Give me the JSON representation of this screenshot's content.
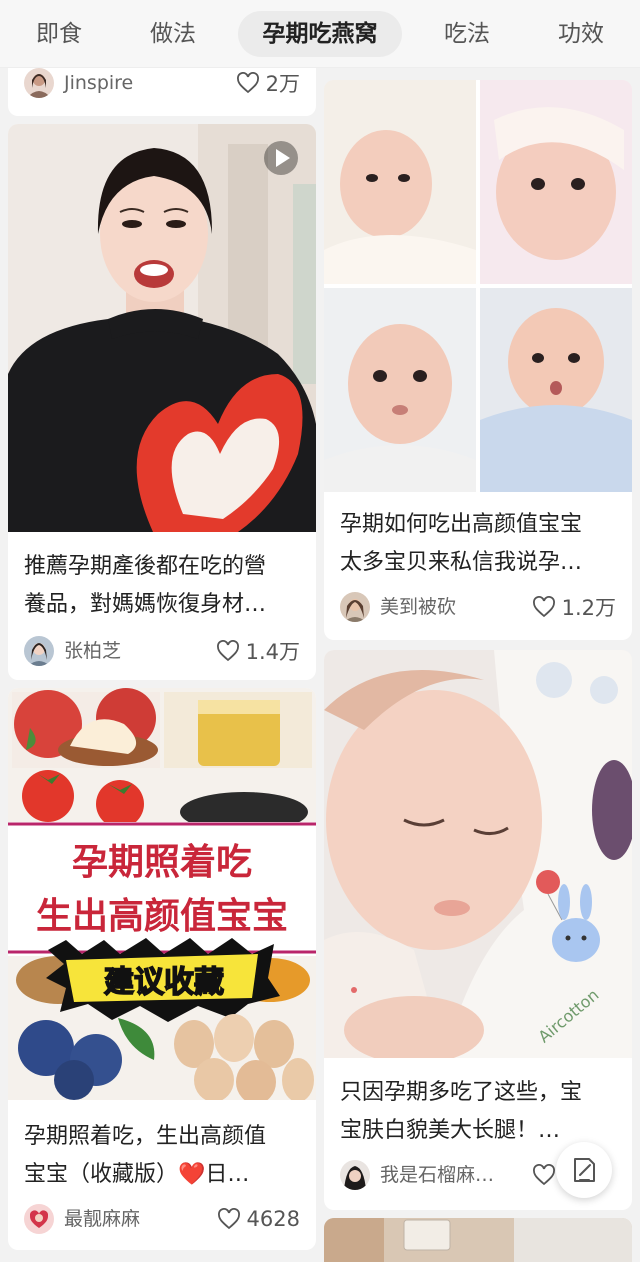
{
  "tabs": [
    {
      "label": "即食"
    },
    {
      "label": "做法"
    },
    {
      "label": "孕期吃燕窝"
    },
    {
      "label": "吃法"
    },
    {
      "label": "功效"
    }
  ],
  "posts": [
    {
      "author": "Jinspire",
      "likes": "2万"
    },
    {
      "title_lines": [
        "推薦孕期產後都在吃的營",
        "養品，對媽媽恢復身材…"
      ],
      "author": "张柏芝",
      "likes": "1.4万"
    },
    {
      "title_lines": [
        "孕期照着吃，生出高颜值",
        "宝宝（收藏版）❤️日…"
      ],
      "author": "最靓麻麻",
      "likes": "4628",
      "cover": {
        "line1": "孕期照着吃",
        "line2": "生出高颜值宝宝",
        "sticker": "建议收藏"
      }
    },
    {
      "title_lines": [
        "孕期如何吃出高颜值宝宝",
        "太多宝贝来私信我说孕…"
      ],
      "author": "美到被砍",
      "likes": "1.2万"
    },
    {
      "title_lines": [
        "只因孕期多吃了这些，宝",
        "宝肤白貌美大长腿！…"
      ],
      "author": "我是石榴麻…",
      "likes": ""
    }
  ],
  "fab": {
    "icon": "edit-note-icon"
  }
}
